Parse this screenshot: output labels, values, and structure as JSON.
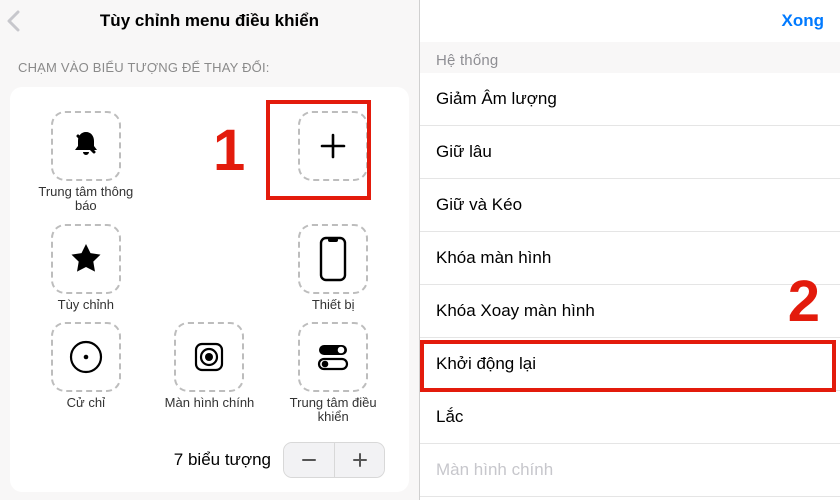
{
  "left": {
    "title": "Tùy chỉnh menu điều khiển",
    "caption": "CHẠM VÀO BIỂU TƯỢNG ĐỂ THAY ĐỔI:",
    "items": [
      {
        "label": "Trung tâm thông báo"
      },
      {
        "label": ""
      },
      {
        "label": ""
      },
      {
        "label": "Tùy chỉnh"
      },
      {
        "label": ""
      },
      {
        "label": "Thiết bị"
      },
      {
        "label": "Cử chỉ"
      },
      {
        "label": "Màn hình chính"
      },
      {
        "label": "Trung tâm điều khiển"
      }
    ],
    "count_text": "7 biểu tượng"
  },
  "right": {
    "done": "Xong",
    "section": "Hệ thống",
    "rows": [
      "Giảm Âm lượng",
      "Giữ lâu",
      "Giữ và Kéo",
      "Khóa màn hình",
      "Khóa Xoay màn hình",
      "Khởi động lại",
      "Lắc",
      "Màn hình chính"
    ]
  },
  "annotations": {
    "one": "1",
    "two": "2"
  }
}
